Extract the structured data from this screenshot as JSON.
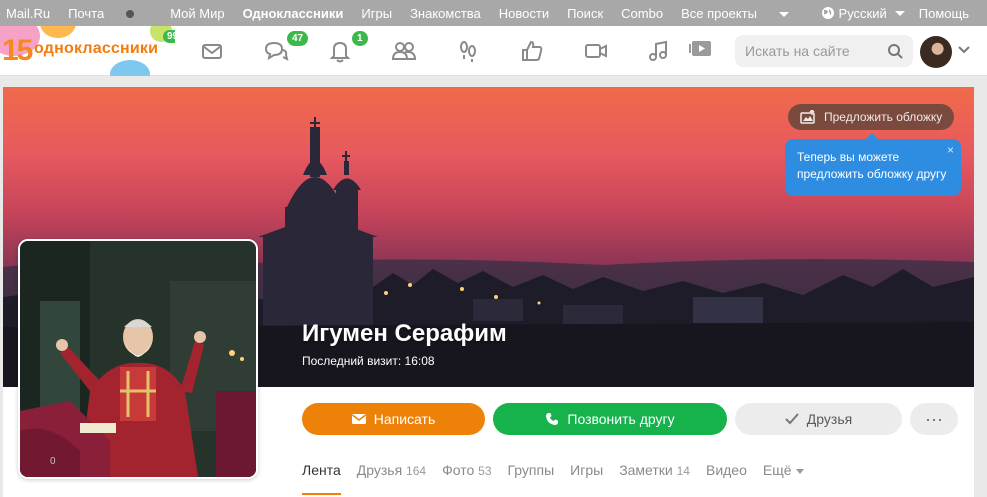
{
  "topbar": {
    "links": [
      "Mail.Ru",
      "Почта",
      "Мой Мир",
      "Одноклассники",
      "Игры",
      "Знакомства",
      "Новости",
      "Поиск",
      "Combo",
      "Все проекты"
    ],
    "language": "Русский",
    "help": "Помощь"
  },
  "header": {
    "logo_text": "одноклассники",
    "logo_number": "15",
    "logo_badge": "99+",
    "badges": {
      "discussions": "47",
      "notifications": "1"
    },
    "search_placeholder": "Искать на сайте"
  },
  "cover": {
    "suggest_cover": "Предложить обложку",
    "tooltip": "Теперь вы можете предложить обложку другу",
    "tooltip_close": "×"
  },
  "profile": {
    "name": "Игумен Серафим",
    "last_visit": "Последний визит: 16:08",
    "photo_counter": "0"
  },
  "actions": {
    "write": "Написать",
    "call": "Позвонить другу",
    "friends": "Друзья",
    "more": "···"
  },
  "tabs": [
    {
      "label": "Лента",
      "count": ""
    },
    {
      "label": "Друзья",
      "count": "164"
    },
    {
      "label": "Фото",
      "count": "53"
    },
    {
      "label": "Группы",
      "count": ""
    },
    {
      "label": "Игры",
      "count": ""
    },
    {
      "label": "Заметки",
      "count": "14"
    },
    {
      "label": "Видео",
      "count": ""
    },
    {
      "label": "Ещё",
      "count": ""
    }
  ],
  "colors": {
    "accent": "#ee8208",
    "call": "#16b24b",
    "badge": "#3cb94a",
    "tooltip": "#2e8de0"
  }
}
